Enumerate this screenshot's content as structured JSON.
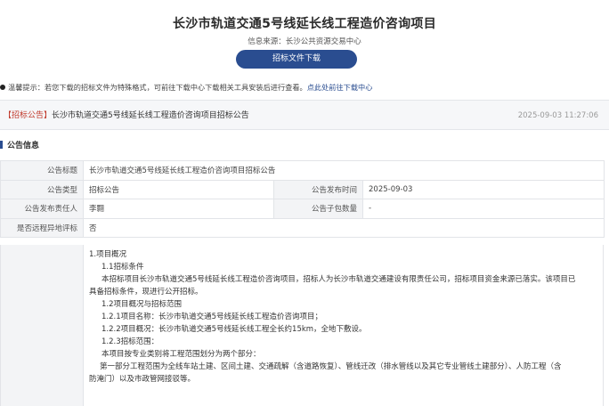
{
  "header": {
    "title": "长沙市轨道交通5号线延长线工程造价咨询项目",
    "source": "信息来源：长沙公共资源交易中心",
    "download_label": "招标文件下载"
  },
  "tip": {
    "text": "温馨提示：若您下载的招标文件为特殊格式，可前往下载中心下载相关工具安装后进行查看。",
    "link": "点此处前往下载中心"
  },
  "notice": {
    "tag": "【招标公告】",
    "title": "长沙市轨道交通5号线延长线工程造价咨询项目招标公告",
    "date": "2025-09-03 11:27:06"
  },
  "section": {
    "title": "公告信息"
  },
  "info_table": {
    "rows": [
      {
        "label": "公告标题",
        "value": "长沙市轨道交通5号线延长线工程造价咨询项目招标公告"
      },
      {
        "label": "公告类型",
        "value": "招标公告",
        "label2": "公告发布时间",
        "value2": "2025-09-03"
      },
      {
        "label": "公告发布责任人",
        "value": "李翾",
        "label2": "公告子包数量",
        "value2": "-"
      },
      {
        "label": "是否远程异地评标",
        "value": "否"
      }
    ]
  },
  "content": {
    "lines": [
      "1.项目概况",
      "1.1招标条件",
      "本招标项目长沙市轨道交通5号线延长线工程造价咨询项目，招标人为长沙市轨道交通建设有限责任公司，招标项目资金来源已落实。该项目已",
      "具备招标条件，现进行公开招标。",
      "1.2项目概况与招标范围",
      "1.2.1项目名称：长沙市轨道交通5号线延长线工程造价咨询项目；",
      "1.2.2项目概况：长沙市轨道交通5号线延长线工程全长约15km，全地下敷设。",
      "1.2.3招标范围：",
      "本项目按专业类别将工程范围划分为两个部分：",
      "第一部分工程范围为全线车站土建、区间土建、交通疏解（含道路恢复）、管线迁改（排水管线以及其它专业管线土建部分）、人防工程（含",
      "防淹门）以及市政管网接驳等。"
    ]
  }
}
